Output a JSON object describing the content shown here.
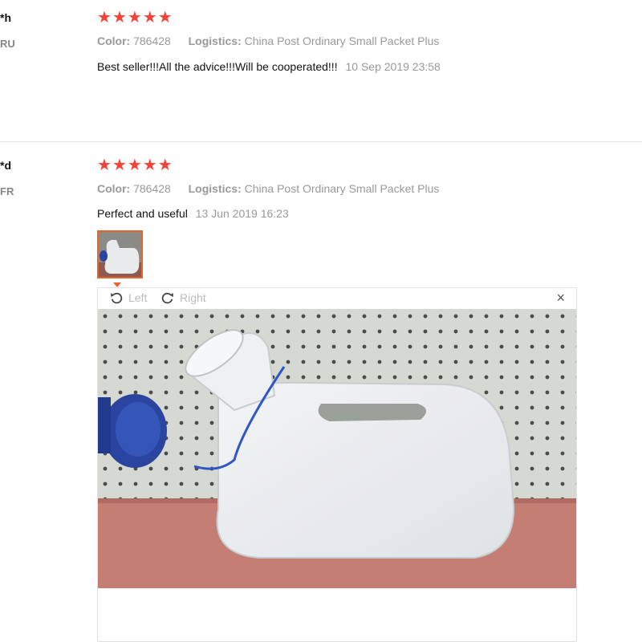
{
  "reviews": [
    {
      "user": "*h",
      "country": "RU",
      "rating": 5,
      "color_label": "Color:",
      "color_value": "786428",
      "logistics_label": "Logistics:",
      "logistics_value": "China Post Ordinary Small Packet Plus",
      "text": "Best seller!!!All the advice!!!Will be cooperated!!!",
      "date": "10 Sep 2019 23:58"
    },
    {
      "user": "*d",
      "country": "FR",
      "rating": 5,
      "color_label": "Color:",
      "color_value": "786428",
      "logistics_label": "Logistics:",
      "logistics_value": "China Post Ordinary Small Packet Plus",
      "text": "Perfect and useful",
      "date": "13 Jun 2019 16:23"
    }
  ],
  "viewer": {
    "rotate_left": "Left",
    "rotate_right": "Right",
    "close": "×"
  },
  "icons": [
    "star-icon",
    "rotate-left-icon",
    "rotate-right-icon",
    "close-icon"
  ],
  "colors": {
    "star": "#f44336",
    "thumb_border": "#e8632a",
    "muted": "#999999"
  }
}
